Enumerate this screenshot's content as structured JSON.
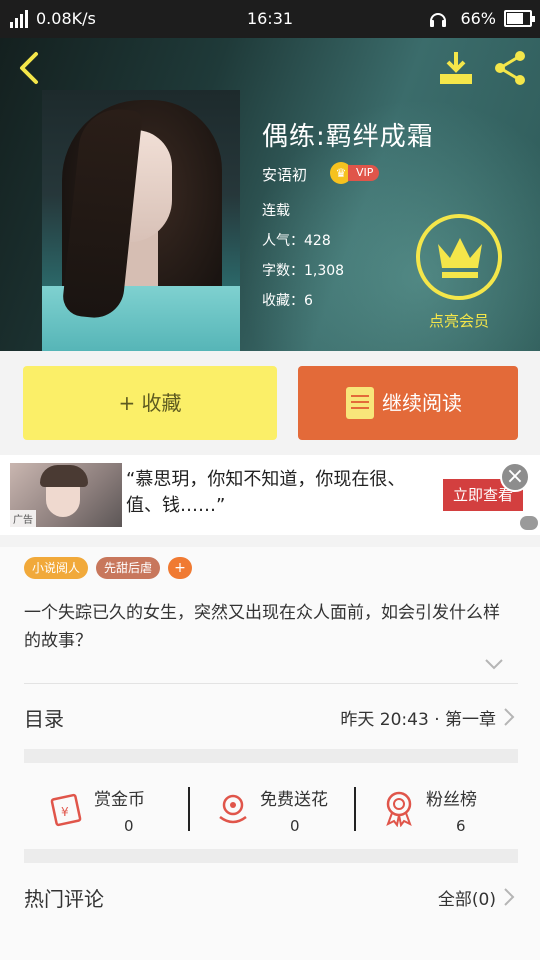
{
  "status_bar": {
    "network": "4G",
    "speed": "0.08K/s",
    "time": "16:31",
    "battery": "66%",
    "battery_level": 0.66
  },
  "book": {
    "title": "偶练:羁绊成霜",
    "author": "安语初",
    "vip_label": "VIP",
    "status": "连载",
    "popularity": "人气：428",
    "word_count": "字数：1,308",
    "favorites": "收藏：6",
    "light_member_label": "点亮会员"
  },
  "actions": {
    "favorite_label": "+ 收藏",
    "continue_label": "继续阅读"
  },
  "ad": {
    "text": "“慕思玥，你知不知道，你现在很、值、钱……”",
    "tag": "广告",
    "cta": "立即查看",
    "close": "×"
  },
  "tags": [
    "小说阅人",
    "先甜后虐",
    "+"
  ],
  "synopsis": "一个失踪已久的女生，突然又出现在众人面前，如会引发什么样的故事？",
  "toc": {
    "label": "目录",
    "latest": "昨天 20:43 · 第一章"
  },
  "stats": [
    {
      "label": "赏金币",
      "count": "0",
      "icon": "red-envelope-icon"
    },
    {
      "label": "免费送花",
      "count": "0",
      "icon": "flower-icon"
    },
    {
      "label": "粉丝榜",
      "count": "6",
      "icon": "medal-icon"
    }
  ],
  "comments": {
    "label": "热门评论",
    "all": "全部(0)"
  },
  "colors": {
    "favorite_button": "#fbef68",
    "read_button": "#e36a39",
    "vip_gold": "#f4e64a",
    "ad_button": "#d33f3f"
  }
}
